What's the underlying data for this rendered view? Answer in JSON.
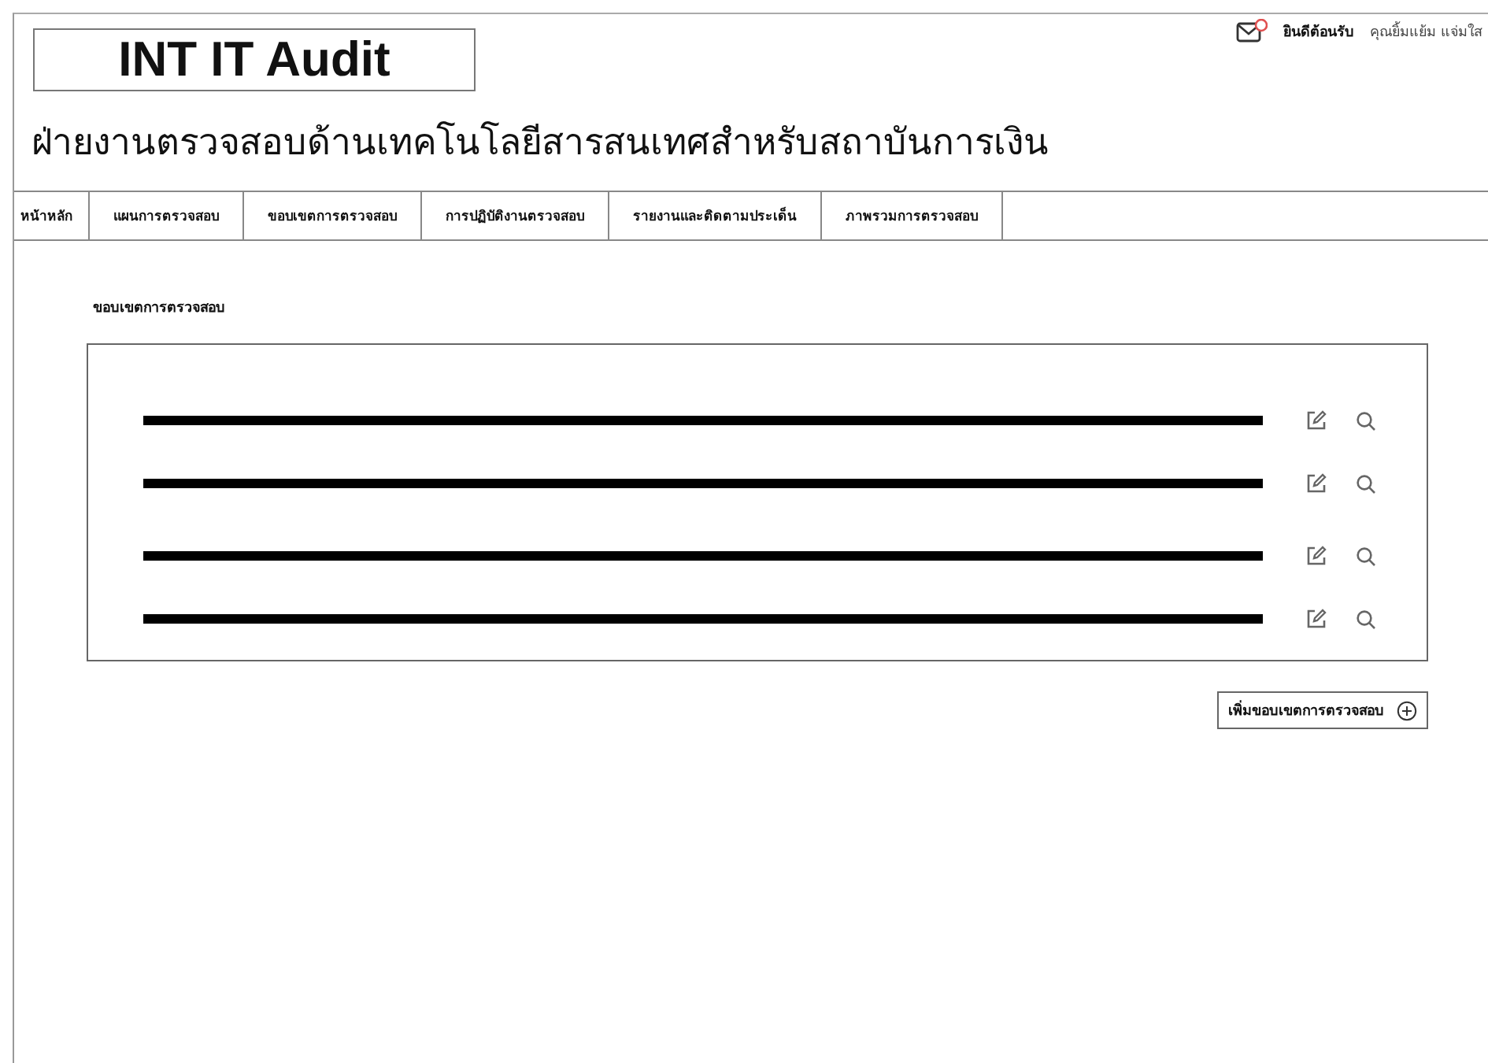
{
  "header": {
    "mail": {
      "unread": true
    },
    "greeting": "ยินดีต้อนรับ",
    "user_name": "คุณยิ้มแย้ม แจ่มใส"
  },
  "logo": "INT IT Audit",
  "subtitle": "ฝ่ายงานตรวจสอบด้านเทคโนโลยีสารสนเทศสำหรับสถาบันการเงิน",
  "nav": [
    {
      "label": "หน้าหลัก",
      "selected": false
    },
    {
      "label": "แผนการตรวจสอบ",
      "selected": false
    },
    {
      "label": "ขอบเขตการตรวจสอบ",
      "selected": false
    },
    {
      "label": "การปฏิบัติงานตรวจสอบ",
      "selected": false
    },
    {
      "label": "รายงานและติดตามประเด็น",
      "selected": false
    },
    {
      "label": "ภาพรวมการตรวจสอบ",
      "selected": false
    }
  ],
  "section_title": "ขอบเขตการตรวจสอบ",
  "rows": [
    {
      "kind": "placeholder"
    },
    {
      "kind": "placeholder"
    },
    {
      "kind": "placeholder"
    },
    {
      "kind": "placeholder"
    }
  ],
  "add_button": "เพิ่มขอบเขตการตรวจสอบ"
}
